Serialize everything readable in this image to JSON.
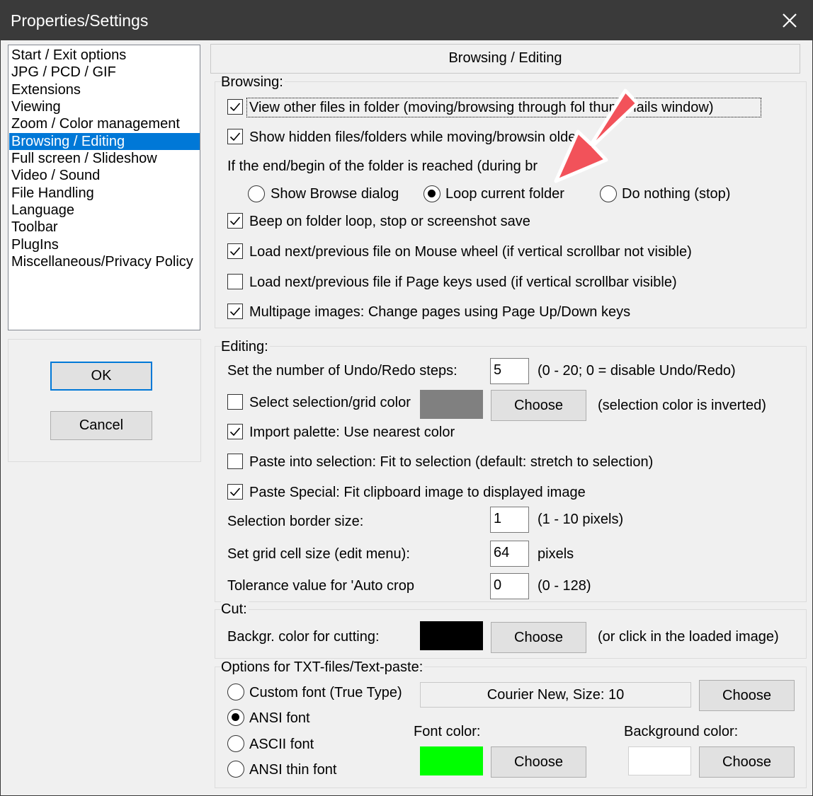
{
  "window": {
    "title": "Properties/Settings"
  },
  "sidebar": {
    "items": [
      "Start / Exit options",
      "JPG / PCD / GIF",
      "Extensions",
      "Viewing",
      "Zoom / Color management",
      "Browsing / Editing",
      "Full screen / Slideshow",
      "Video / Sound",
      "File Handling",
      "Language",
      "Toolbar",
      "PlugIns",
      "Miscellaneous/Privacy Policy"
    ],
    "selected_index": 5
  },
  "buttons": {
    "ok": "OK",
    "cancel": "Cancel",
    "choose": "Choose"
  },
  "panel": {
    "header": "Browsing / Editing"
  },
  "browsing": {
    "legend": "Browsing:",
    "view_other": {
      "label": "View other files in folder (moving/browsing through fol    thumbnails window)",
      "checked": true
    },
    "show_hidden": {
      "label": "Show hidden files/folders while moving/browsin        older",
      "checked": true
    },
    "end_text": "If the end/begin of the folder is reached (during br",
    "radios": [
      {
        "label": "Show Browse dialog",
        "selected": false
      },
      {
        "label": "Loop current folder",
        "selected": true
      },
      {
        "label": "Do nothing (stop)",
        "selected": false
      }
    ],
    "beep": {
      "label": "Beep on folder loop, stop or screenshot save",
      "checked": true
    },
    "load_wheel": {
      "label": "Load next/previous file on Mouse wheel (if vertical scrollbar not visible)",
      "checked": true
    },
    "load_page": {
      "label": "Load next/previous file if Page keys used (if vertical scrollbar visible)",
      "checked": false
    },
    "multipage": {
      "label": "Multipage images: Change pages using Page Up/Down keys",
      "checked": true
    }
  },
  "editing": {
    "legend": "Editing:",
    "undo_label": "Set the number of Undo/Redo steps:",
    "undo_value": "5",
    "undo_hint": "(0 - 20; 0 = disable Undo/Redo)",
    "sel_color": {
      "label": "Select selection/grid color",
      "checked": false
    },
    "sel_color_swatch": "#808080",
    "sel_color_hint": "(selection color is inverted)",
    "import_palette": {
      "label": "Import palette: Use nearest color",
      "checked": true
    },
    "paste_into": {
      "label": "Paste into selection: Fit to selection (default: stretch to selection)",
      "checked": false
    },
    "paste_special": {
      "label": "Paste Special: Fit clipboard image to displayed image",
      "checked": true
    },
    "border_label": "Selection border size:",
    "border_value": "1",
    "border_hint": "(1 - 10 pixels)",
    "grid_label": "Set grid cell size (edit menu):",
    "grid_value": "64",
    "grid_hint": "pixels",
    "tolerance_label": "Tolerance value for 'Auto crop",
    "tolerance_value": "0",
    "tolerance_hint": "(0 - 128)"
  },
  "cut": {
    "legend": "Cut:",
    "bg_label": "Backgr. color for cutting:",
    "bg_swatch": "#000000",
    "bg_hint": "(or click in the loaded image)"
  },
  "txt": {
    "legend": "Options for TXT-files/Text-paste:",
    "radios": [
      {
        "label": "Custom font (True Type)",
        "selected": false
      },
      {
        "label": "ANSI font",
        "selected": true
      },
      {
        "label": "ASCII font",
        "selected": false
      },
      {
        "label": "ANSI thin font",
        "selected": false
      }
    ],
    "font_display": "Courier New, Size: 10",
    "font_color_label": "Font color:",
    "font_color_swatch": "#00ff00",
    "bg_color_label": "Background color:",
    "bg_color_swatch": "#ffffff"
  },
  "colors": {
    "title_bg": "#3a3a3a",
    "selection": "#0078d7",
    "arrow": "#f2525a"
  }
}
